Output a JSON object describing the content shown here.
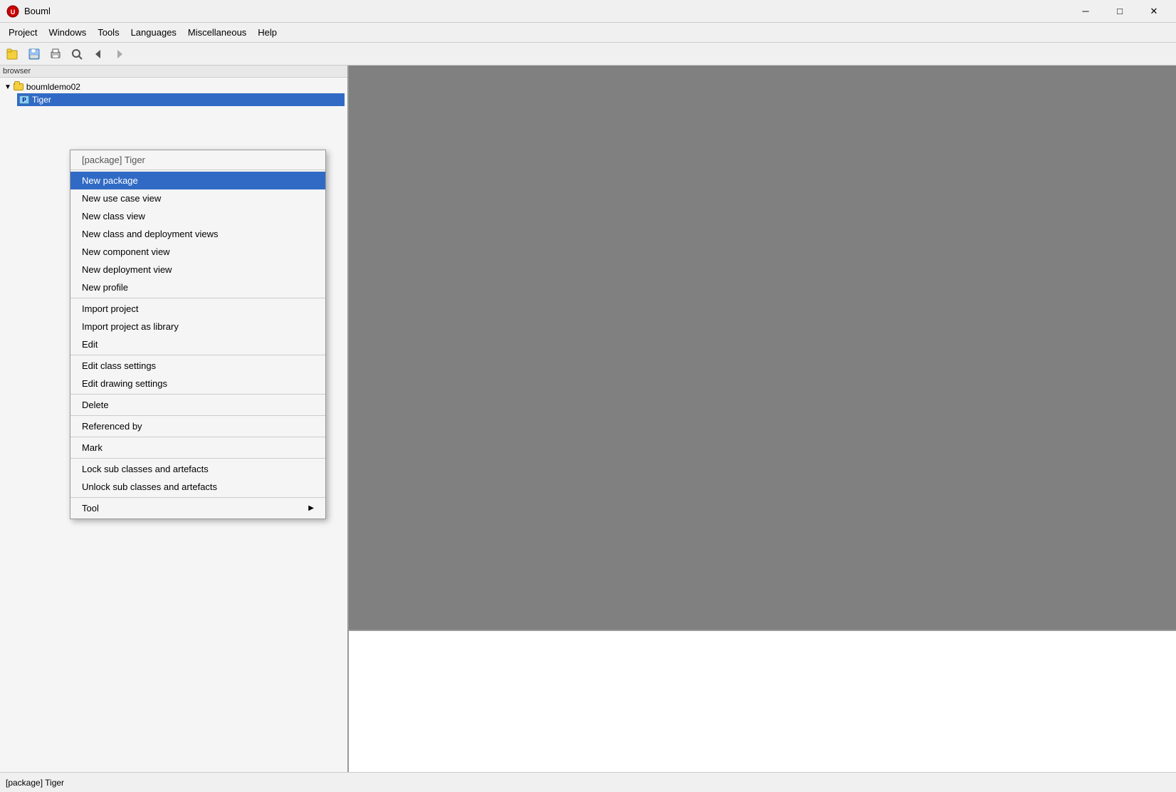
{
  "window": {
    "title": "Bouml",
    "icon": "UML"
  },
  "titlebar": {
    "minimize_label": "─",
    "maximize_label": "□",
    "close_label": "✕"
  },
  "menubar": {
    "items": [
      {
        "label": "Project"
      },
      {
        "label": "Windows"
      },
      {
        "label": "Tools"
      },
      {
        "label": "Languages"
      },
      {
        "label": "Miscellaneous"
      },
      {
        "label": "Help"
      }
    ]
  },
  "toolbar": {
    "buttons": [
      {
        "name": "open-icon",
        "glyph": "📂"
      },
      {
        "name": "save-icon",
        "glyph": "💾"
      },
      {
        "name": "print-icon",
        "glyph": "🖨"
      },
      {
        "name": "zoom-icon",
        "glyph": "🔍"
      },
      {
        "name": "back-icon",
        "glyph": "←"
      },
      {
        "name": "forward-icon",
        "glyph": "→"
      }
    ]
  },
  "browser": {
    "label": "browser",
    "root": "boumldemо02",
    "selected_item": "Tiger"
  },
  "context_menu": {
    "header": "[package] Tiger",
    "items": [
      {
        "label": "New package",
        "highlighted": true,
        "separator_after": false
      },
      {
        "label": "New use case view",
        "highlighted": false
      },
      {
        "label": "New class view",
        "highlighted": false
      },
      {
        "label": "New class and deployment views",
        "highlighted": false
      },
      {
        "label": "New component view",
        "highlighted": false
      },
      {
        "label": "New deployment view",
        "highlighted": false
      },
      {
        "label": "New profile",
        "highlighted": false,
        "separator_after": true
      },
      {
        "label": "Import project",
        "highlighted": false
      },
      {
        "label": "Import project as library",
        "highlighted": false
      },
      {
        "label": "Edit",
        "highlighted": false,
        "separator_after": true
      },
      {
        "label": "Edit class settings",
        "highlighted": false
      },
      {
        "label": "Edit drawing settings",
        "highlighted": false,
        "separator_after": true
      },
      {
        "label": "Delete",
        "highlighted": false,
        "separator_after": true
      },
      {
        "label": "Referenced by",
        "highlighted": false,
        "separator_after": true
      },
      {
        "label": "Mark",
        "highlighted": false,
        "separator_after": true
      },
      {
        "label": "Lock sub classes and artefacts",
        "highlighted": false
      },
      {
        "label": "Unlock sub classes and artefacts",
        "highlighted": false,
        "separator_after": true
      },
      {
        "label": "Tool",
        "highlighted": false,
        "has_submenu": true
      }
    ]
  },
  "statusbar": {
    "text": "[package] Tiger"
  }
}
